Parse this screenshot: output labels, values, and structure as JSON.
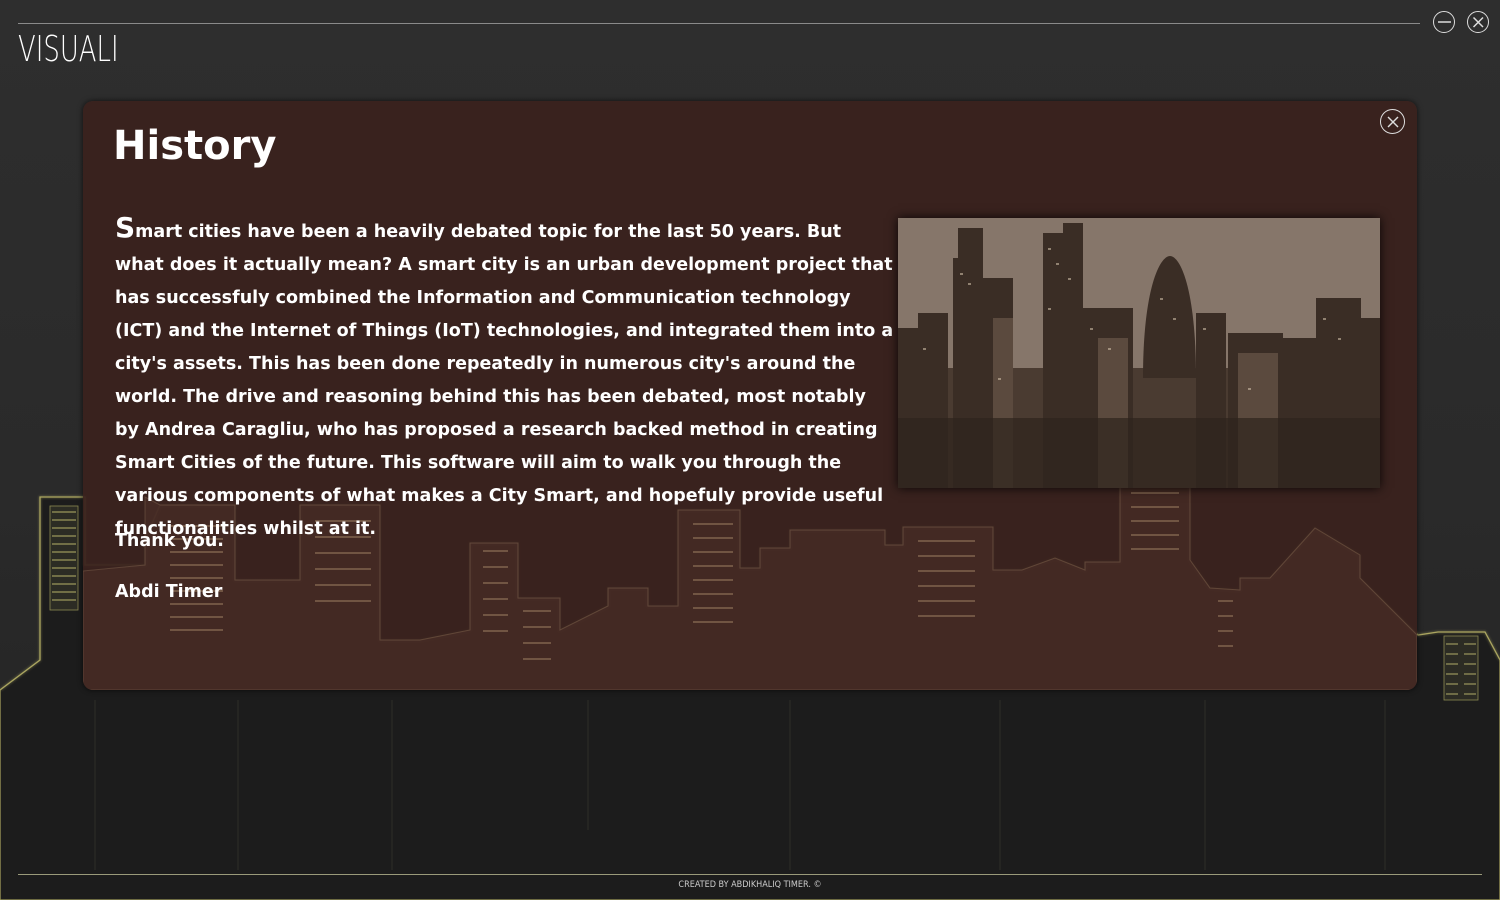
{
  "app": {
    "title": "VISUALI",
    "minimize_icon": "minimize-icon",
    "close_icon": "close-icon"
  },
  "modal": {
    "title": "History",
    "close_icon": "close-icon",
    "drop_cap": "S",
    "body_text": "mart cities have been a heavily debated topic for the last 50 years. But what does it actually mean? A smart city is an urban development project that has successfuly combined the Information and Communication technology (ICT) and the Internet of Things (IoT) technologies, and integrated them into a city's assets. This has been done repeatedly in numerous city's around the world. The drive and reasoning behind this has been debated, most notably by Andrea Caragliu, who has proposed a research backed method in creating Smart Cities of the future. This software will aim to walk you through the various components of what makes a City Smart, and hopefuly provide useful functionalities whilst at it.",
    "thanks": "Thank you.",
    "author": "Abdi Timer",
    "photo_alt": "city-skyline-photo"
  },
  "footer": {
    "credit": "CREATED BY ABDIKHALIQ TIMER. ©"
  },
  "colors": {
    "background": "#2b2b2b",
    "modal": "#3a221e",
    "skyline_outline": "#b9b46a",
    "text": "#ffffff"
  }
}
